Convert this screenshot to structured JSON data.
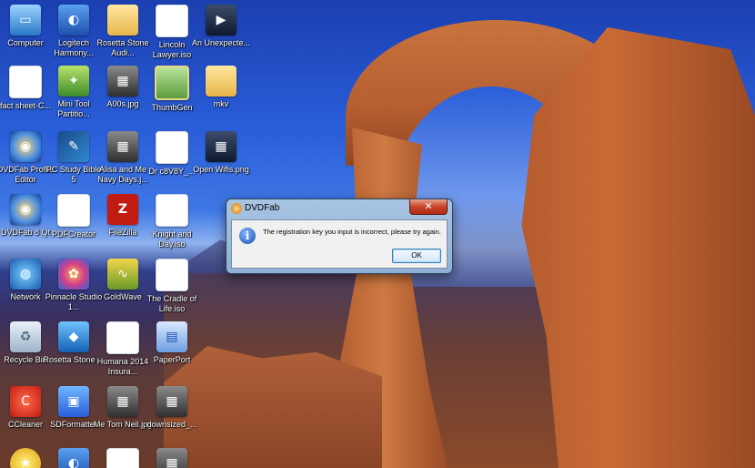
{
  "desktop": {
    "icons": [
      {
        "label": "Computer",
        "icon": "computer-icon"
      },
      {
        "label": "Logitech Harmony...",
        "icon": "logitech-harmony-icon"
      },
      {
        "label": "Rosetta Stone Audi...",
        "icon": "folder-icon"
      },
      {
        "label": "Lincoln Lawyer.iso",
        "icon": "iso-file-icon"
      },
      {
        "label": "An Unexpecte...",
        "icon": "video-file-icon"
      },
      {
        "label": "fact sheet-C...",
        "icon": "pdf-file-icon"
      },
      {
        "label": "Mini Tool Partitio...",
        "icon": "minitool-partition-icon"
      },
      {
        "label": "A00s.jpg",
        "icon": "photo-file-icon"
      },
      {
        "label": "ThumbGen",
        "icon": "thumbgen-icon"
      },
      {
        "label": "mkv",
        "icon": "folder-icon"
      },
      {
        "label": "DVDFab Profile Editor",
        "icon": "dvdfab-profile-editor-icon"
      },
      {
        "label": "PC Study Bible 5",
        "icon": "pc-study-bible-icon"
      },
      {
        "label": "Alisa and Me Navy Days.j...",
        "icon": "photo-file-icon"
      },
      {
        "label": "Dr c8V8Y_...",
        "icon": "pdf-file-icon"
      },
      {
        "label": "Open Wifis.png",
        "icon": "image-file-icon"
      },
      {
        "label": "DVDFab 8 Qt",
        "icon": "dvdfab-icon"
      },
      {
        "label": "PDFCreator",
        "icon": "pdfcreator-icon"
      },
      {
        "label": "FileZilla",
        "icon": "filezilla-icon"
      },
      {
        "label": "Knight and Day.iso",
        "icon": "iso-file-icon"
      },
      {
        "label": "Network",
        "icon": "network-icon"
      },
      {
        "label": "Pinnacle Studio 1...",
        "icon": "pinnacle-studio-icon"
      },
      {
        "label": "GoldWave",
        "icon": "goldwave-icon"
      },
      {
        "label": "The Cradle of Life.iso",
        "icon": "iso-file-icon"
      },
      {
        "label": "Recycle Bin",
        "icon": "recycle-bin-icon"
      },
      {
        "label": "Rosetta Stone ...",
        "icon": "rosetta-stone-icon"
      },
      {
        "label": "Humana 2014 Insura...",
        "icon": "pdf-file-icon"
      },
      {
        "label": "PaperPort",
        "icon": "paperport-icon"
      },
      {
        "label": "CCleaner",
        "icon": "ccleaner-icon"
      },
      {
        "label": "SDFormatter",
        "icon": "sdformatter-icon"
      },
      {
        "label": "Me Tom Neil.jpg",
        "icon": "photo-file-icon"
      },
      {
        "label": "downsized_...",
        "icon": "photo-file-icon"
      }
    ]
  },
  "dialog": {
    "title": "DVDFab",
    "close_label": "✕",
    "message": "The registration key you input is incorrect, please try again.",
    "ok_label": "OK"
  }
}
